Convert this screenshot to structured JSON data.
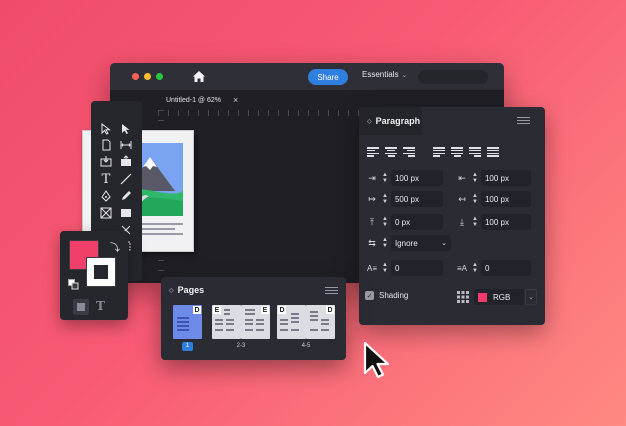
{
  "window": {
    "share_label": "Share",
    "workspace_label": "Essentials",
    "doc_tab_title": "Untitled-1 @ 62%",
    "doc_tab_close": "×"
  },
  "paragraph": {
    "title": "Paragraph",
    "left_indent": "100 px",
    "right_indent": "100 px",
    "first_line_indent": "500 px",
    "last_line_indent": "100 px",
    "space_before": "0 px",
    "space_after": "100 px",
    "hyphenation": "Ignore",
    "drop_cap_lines": "0",
    "drop_cap_chars": "0",
    "shading_label": "Shading",
    "color_mode": "RGB"
  },
  "pages": {
    "title": "Pages",
    "thumbs": [
      {
        "label": "1",
        "letters": [
          "D"
        ]
      },
      {
        "label": "2-3",
        "letters": [
          "E",
          "E"
        ]
      },
      {
        "label": "4-5",
        "letters": [
          "D",
          "D"
        ]
      }
    ]
  },
  "colors": {
    "accent": "#2f7fe0",
    "fill_swatch": "#f0406a",
    "page_selected": "#6d8ae8",
    "shading_swatch": "#f03c6a"
  },
  "icons": {
    "home": "home-icon",
    "cursor": "cursor-arrow-icon"
  }
}
